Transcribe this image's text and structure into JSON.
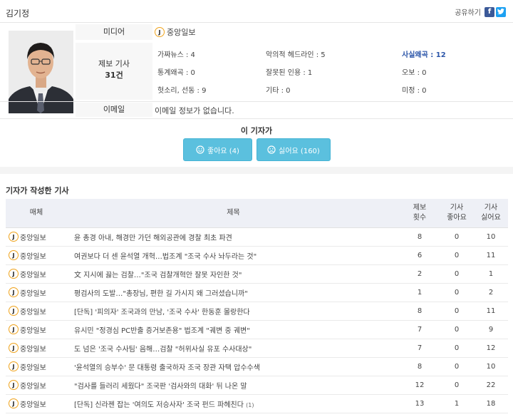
{
  "reporter": {
    "name": "김기정",
    "share_label": "공유하기",
    "media_label": "미디어",
    "media_name": "중앙일보",
    "report_label": "제보 기사",
    "report_count": "31건",
    "email_label": "이메일",
    "email_value": "이메일 정보가 없습니다."
  },
  "stats": [
    {
      "label": "가짜뉴스 : 4"
    },
    {
      "label": "악의적 헤드라인 : 5"
    },
    {
      "label": "사실왜곡 : 12"
    },
    {
      "label": "통계왜곡 : 0"
    },
    {
      "label": "잘못된 인용 : 1"
    },
    {
      "label": "오보 : 0"
    },
    {
      "label": "헛소리, 선동 : 9"
    },
    {
      "label": "기타 : 0"
    },
    {
      "label": "미정 : 0"
    }
  ],
  "vote": {
    "title": "이 기자가",
    "like": "좋아요 (4)",
    "dislike": "싫어요 (160)"
  },
  "articles": {
    "section_title": "기자가 작성한 기사",
    "headers": {
      "media": "매체",
      "title": "제목",
      "reports_1": "제보",
      "reports_2": "횟수",
      "likes_1": "기사",
      "likes_2": "좋아요",
      "dislikes_1": "기사",
      "dislikes_2": "싫어요"
    },
    "rows": [
      {
        "media": "중앙일보",
        "title": "윤 총경 아내, 해경만 가던 해외공관에 경찰 최초 파견",
        "reports": "8",
        "likes": "0",
        "dislikes": "10",
        "comment": ""
      },
      {
        "media": "중앙일보",
        "title": "여권보다 더 센 윤석열 개혁…법조계 \"조국 수사 놔두라는 것\"",
        "reports": "6",
        "likes": "0",
        "dislikes": "11",
        "comment": ""
      },
      {
        "media": "중앙일보",
        "title": "文 지시에 끓는 검찰…\"조국 검찰개혁안 잘못 자인한 것\"",
        "reports": "2",
        "likes": "0",
        "dislikes": "1",
        "comment": ""
      },
      {
        "media": "중앙일보",
        "title": "평검사의 도발…\"총장님, 편한 길 가시지 왜 그러셨습니까\"",
        "reports": "1",
        "likes": "0",
        "dislikes": "2",
        "comment": ""
      },
      {
        "media": "중앙일보",
        "title": "[단독] '피의자' 조국과의 만남, '조국 수사' 한동훈 몰랑한다",
        "reports": "8",
        "likes": "0",
        "dislikes": "11",
        "comment": ""
      },
      {
        "media": "중앙일보",
        "title": "유시민 \"정경심 PC반출 증거보존용\" 법조계 \"궤변 중 궤변\"",
        "reports": "7",
        "likes": "0",
        "dislikes": "9",
        "comment": ""
      },
      {
        "media": "중앙일보",
        "title": "도 넘은 '조국 수사팀' 음해…검찰 \"허위사실 유포 수사대상\"",
        "reports": "7",
        "likes": "0",
        "dislikes": "12",
        "comment": ""
      },
      {
        "media": "중앙일보",
        "title": "'윤석열의 승부수' 문 대통령 출국하자 조국 장관 자택 압수수색",
        "reports": "8",
        "likes": "0",
        "dislikes": "10",
        "comment": ""
      },
      {
        "media": "중앙일보",
        "title": "\"검사를 들러리 세웠다\" 조국판 '검사와의 대화' 뒤 나온 말",
        "reports": "12",
        "likes": "0",
        "dislikes": "22",
        "comment": ""
      },
      {
        "media": "중앙일보",
        "title": "[단독] 신라젠 잡는 '여의도 저승사자' 조국 펀드 파헤친다",
        "reports": "13",
        "likes": "1",
        "dislikes": "18",
        "comment": "(1)"
      }
    ]
  }
}
